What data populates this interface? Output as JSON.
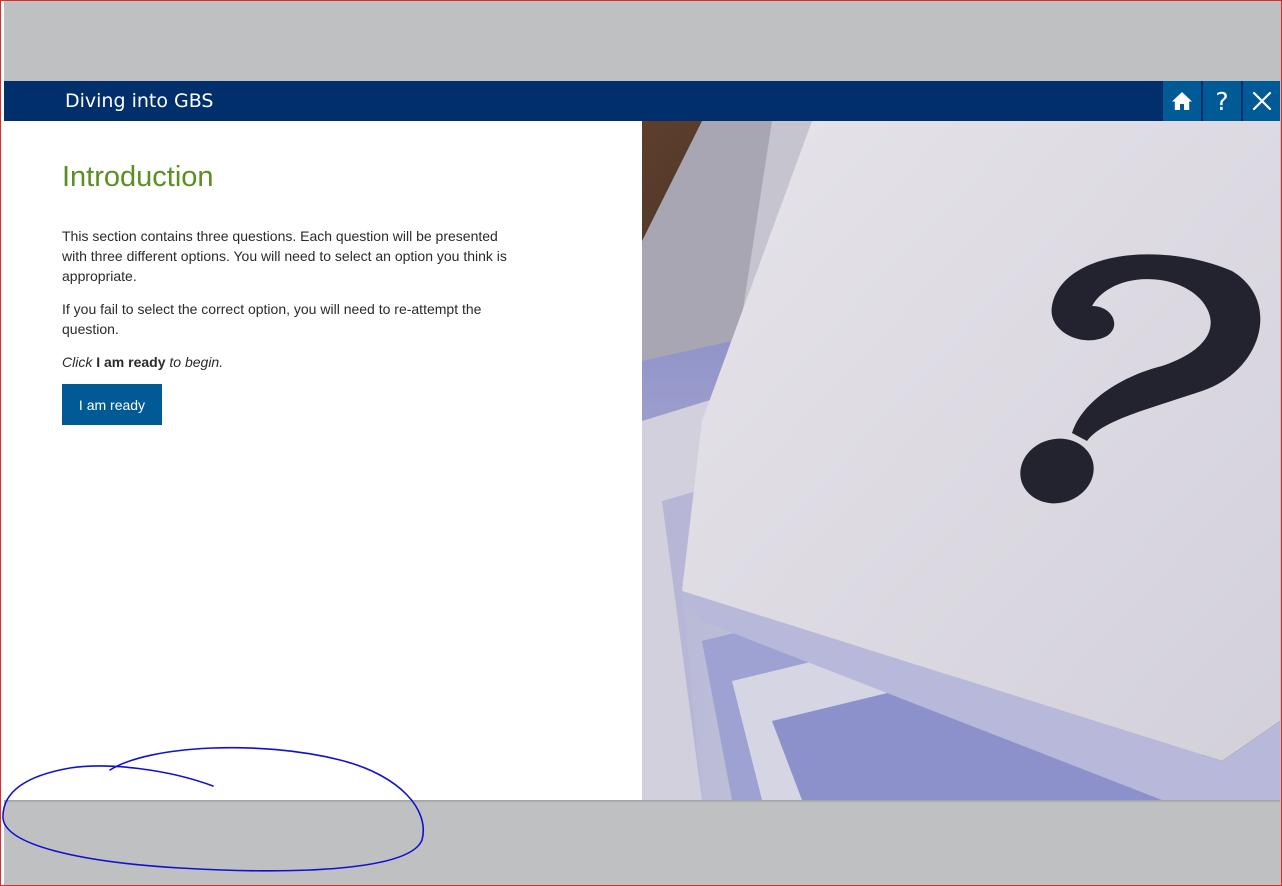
{
  "header": {
    "title": "Diving into GBS",
    "buttons": [
      {
        "name": "home",
        "icon": "home-icon"
      },
      {
        "name": "help",
        "label": "?",
        "icon": "help-icon"
      },
      {
        "name": "close",
        "icon": "close-icon"
      }
    ]
  },
  "main": {
    "title": "Introduction",
    "paragraph_1": "This section contains three questions. Each question will be presented with three different options. You will need to select an option you think is appropriate.",
    "paragraph_2": "If you fail to select the correct option, you will need to re-attempt the question.",
    "instruction_prefix": "Click ",
    "instruction_bold": "I am ready",
    "instruction_suffix": " to begin.",
    "ready_button_label": "I am ready"
  },
  "image": {
    "description_icon": "question-mark-cards-image"
  },
  "colors": {
    "header_bg": "#002f6c",
    "header_button_bg": "#005a96",
    "title_green": "#5b8f22",
    "button_bg": "#005a96",
    "outer_bg": "#bfc0c2",
    "annotation_stroke": "#1010d0"
  }
}
